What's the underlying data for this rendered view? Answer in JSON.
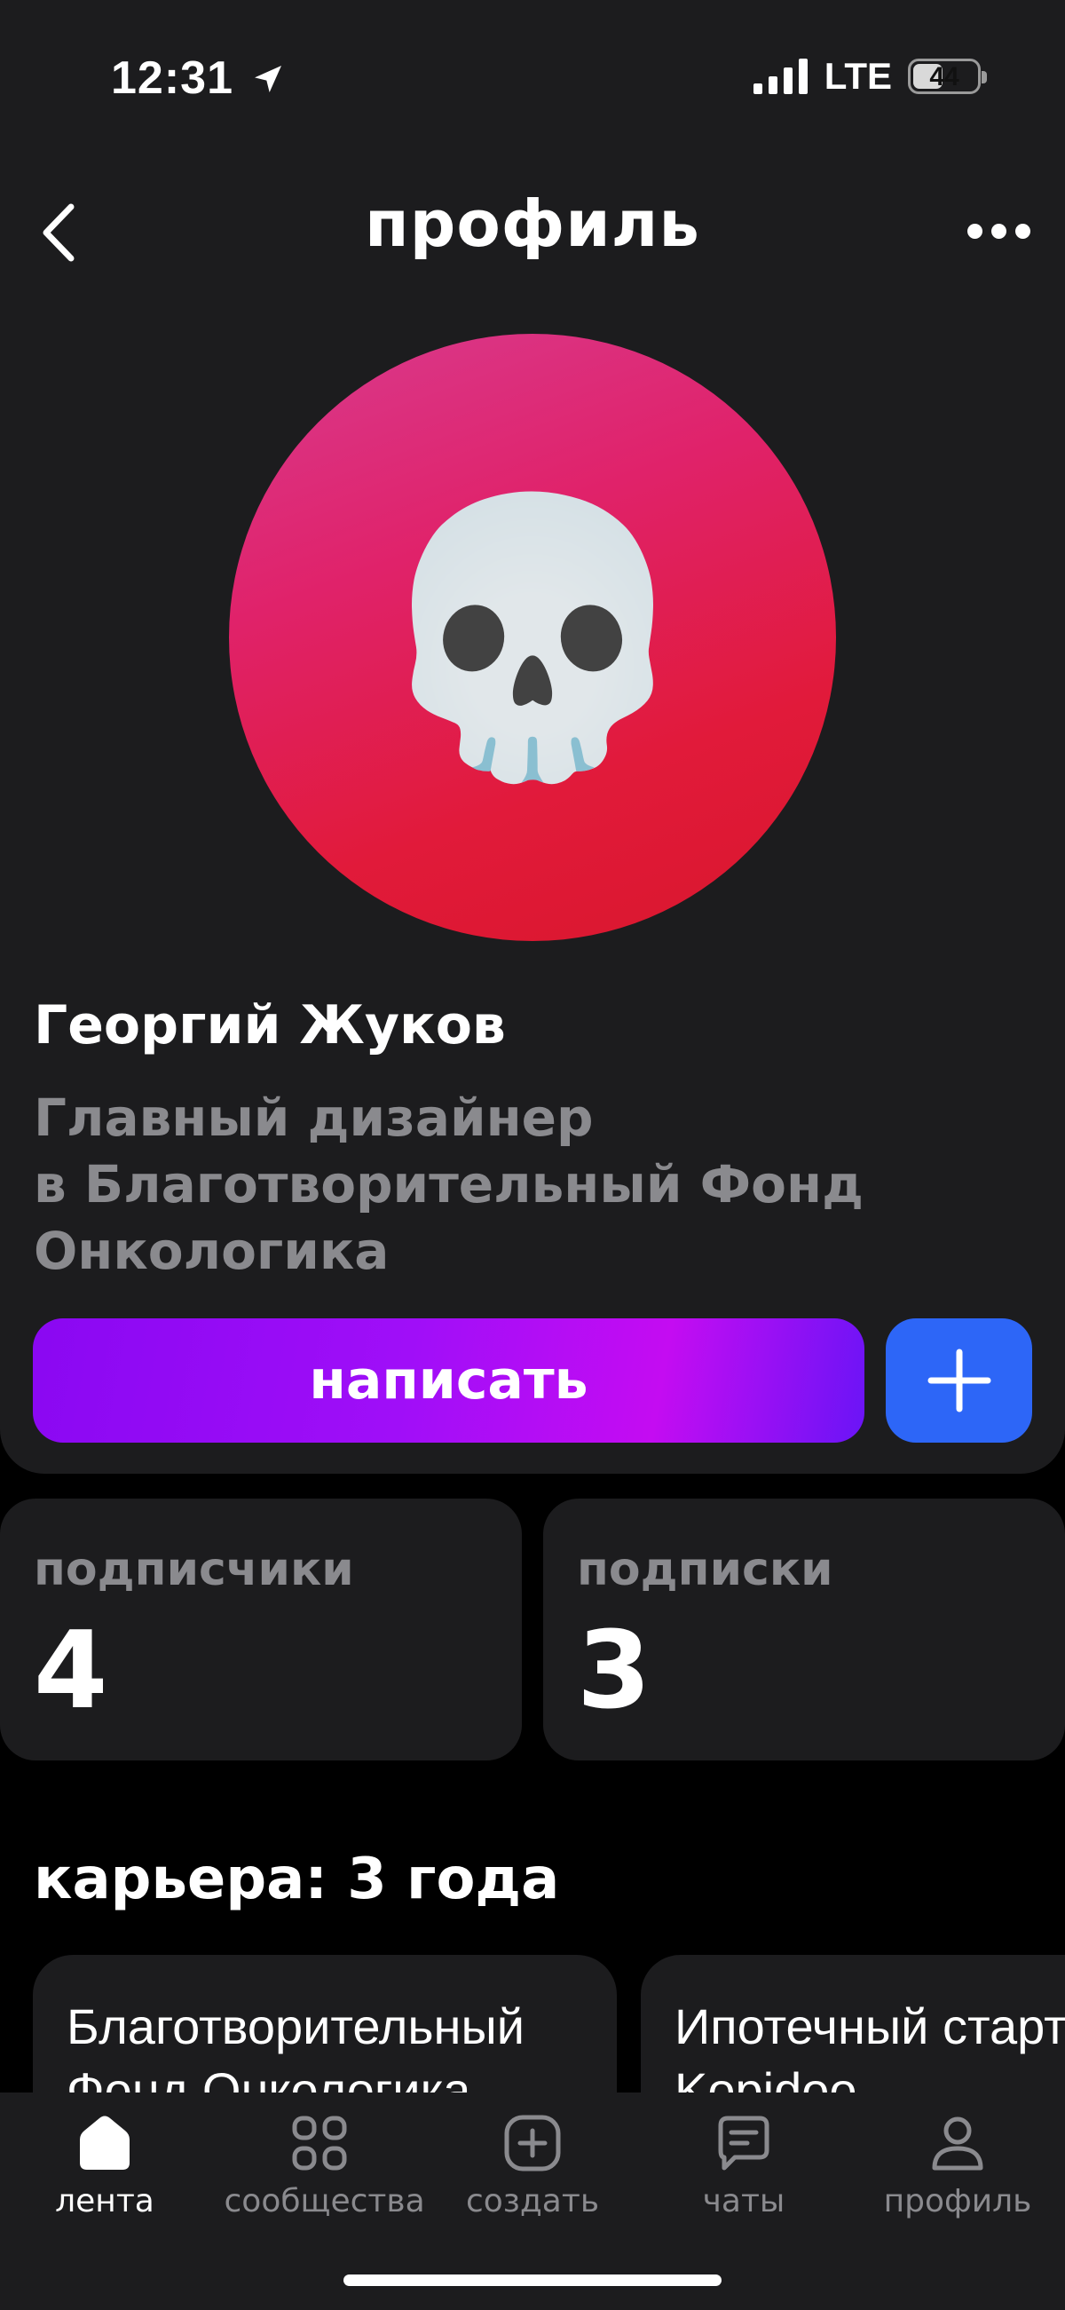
{
  "status_bar": {
    "time": "12:31",
    "network": "LTE",
    "battery": "44"
  },
  "header": {
    "title": "профиль"
  },
  "profile": {
    "avatar_emoji": "💀",
    "name": "Георгий Жуков",
    "job_line1": "Главный дизайнер",
    "job_line2": "в Благотворительный Фонд",
    "job_line3": "Онкологика",
    "write_label": "написать"
  },
  "stats": {
    "followers_label": "подписчики",
    "followers_value": "4",
    "following_label": "подписки",
    "following_value": "3"
  },
  "career": {
    "title": "карьера: 3 года",
    "items": [
      {
        "line1": "Благотворительный",
        "line2": "Фонд Онкологика"
      },
      {
        "line1": "Ипотечный стартап",
        "line2": "Kopidoo"
      }
    ]
  },
  "nav": {
    "tabs": [
      {
        "label": "лента",
        "icon": "home-icon"
      },
      {
        "label": "сообщества",
        "icon": "grid-icon"
      },
      {
        "label": "создать",
        "icon": "plus-square-icon"
      },
      {
        "label": "чаты",
        "icon": "chat-icon"
      },
      {
        "label": "профиль",
        "icon": "person-icon"
      }
    ]
  }
}
